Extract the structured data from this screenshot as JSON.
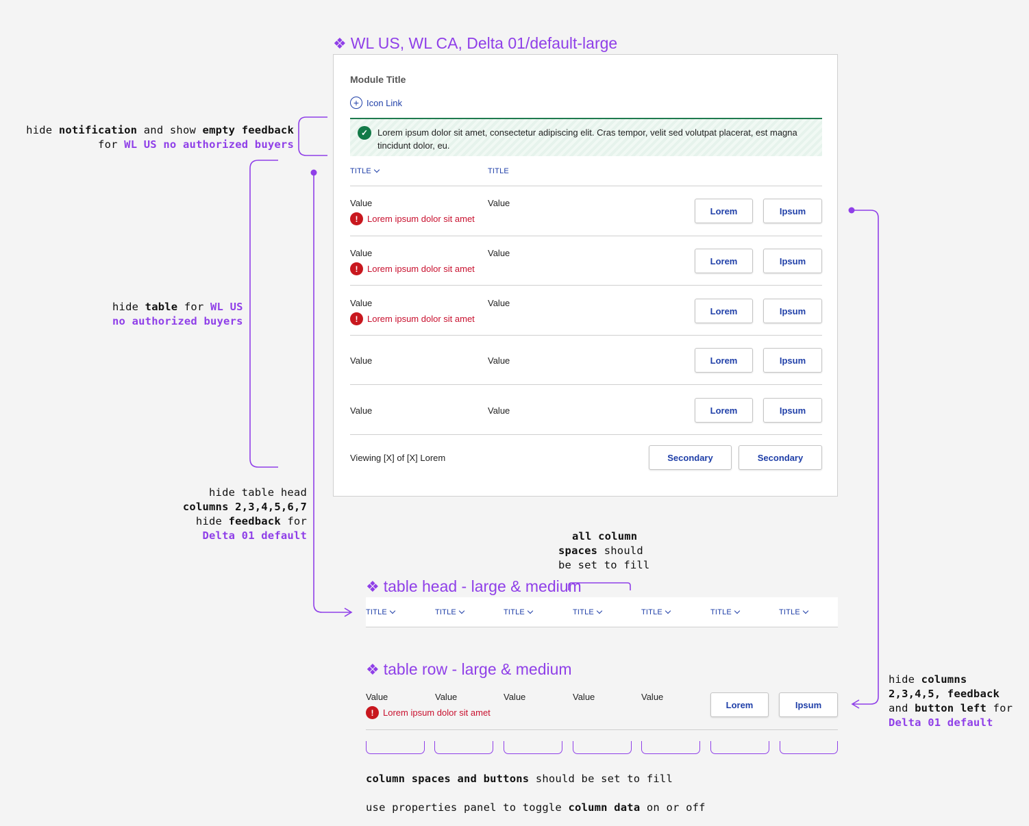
{
  "main_component": {
    "title": "WL US, WL CA, Delta 01/default-large",
    "module_title": "Module Title",
    "icon_link": "Icon Link",
    "notification": "Lorem ipsum dolor sit amet, consectetur adipiscing elit. Cras tempor, velit sed volutpat placerat, est magna tincidunt dolor, eu.",
    "table_head": [
      "TITLE",
      "TITLE"
    ],
    "rows": [
      {
        "col1": "Value",
        "col2": "Value",
        "error": "Lorem ipsum dolor sit amet",
        "btn1": "Lorem",
        "btn2": "Ipsum"
      },
      {
        "col1": "Value",
        "col2": "Value",
        "error": "Lorem ipsum dolor sit amet",
        "btn1": "Lorem",
        "btn2": "Ipsum"
      },
      {
        "col1": "Value",
        "col2": "Value",
        "error": "Lorem ipsum dolor sit amet",
        "btn1": "Lorem",
        "btn2": "Ipsum"
      },
      {
        "col1": "Value",
        "col2": "Value",
        "error": "",
        "btn1": "Lorem",
        "btn2": "Ipsum"
      },
      {
        "col1": "Value",
        "col2": "Value",
        "error": "",
        "btn1": "Lorem",
        "btn2": "Ipsum"
      }
    ],
    "footer_text": "Viewing [X] of [X] Lorem",
    "footer_buttons": [
      "Secondary",
      "Secondary"
    ]
  },
  "annotations": {
    "notification": {
      "line1": [
        "hide ",
        "notification",
        " and show ",
        "empty feedback"
      ],
      "line2": [
        "for ",
        "WL US no authorized buyers"
      ]
    },
    "table": {
      "line1": [
        "hide ",
        "table",
        " for ",
        "WL US"
      ],
      "line2": "no authorized buyers"
    },
    "table_head": {
      "line1": "hide table head",
      "line2": "columns 2,3,4,5,6,7",
      "line3": [
        "hide ",
        "feedback",
        " for"
      ],
      "line4": "Delta 01 default"
    },
    "column_spaces": {
      "line1": "all column",
      "line2": [
        "spaces",
        " should"
      ],
      "line3": "be set to fill"
    },
    "row_columns": {
      "line1": [
        "hide ",
        "columns"
      ],
      "line2": "2,3,4,5, feedback",
      "line3": [
        "and ",
        "button left",
        " for"
      ],
      "line4": "Delta 01 default"
    },
    "bottom1": [
      "column spaces and buttons",
      " should be set to fill"
    ],
    "bottom2": [
      "use properties panel to toggle ",
      "column data",
      " on or off"
    ]
  },
  "table_head_component": {
    "title": "table head - large & medium",
    "headers": [
      "TITLE",
      "TITLE",
      "TITLE",
      "TITLE",
      "TITLE",
      "TITLE",
      "TITLE"
    ]
  },
  "table_row_component": {
    "title": "table row - large & medium",
    "values": [
      "Value",
      "Value",
      "Value",
      "Value",
      "Value"
    ],
    "error": "Lorem ipsum dolor sit amet",
    "btn1": "Lorem",
    "btn2": "Ipsum"
  },
  "colors": {
    "accent_purple": "#8f3fe8",
    "link_blue": "#1f3fa8",
    "error_red": "#c8102e",
    "success_green": "#137a48"
  }
}
